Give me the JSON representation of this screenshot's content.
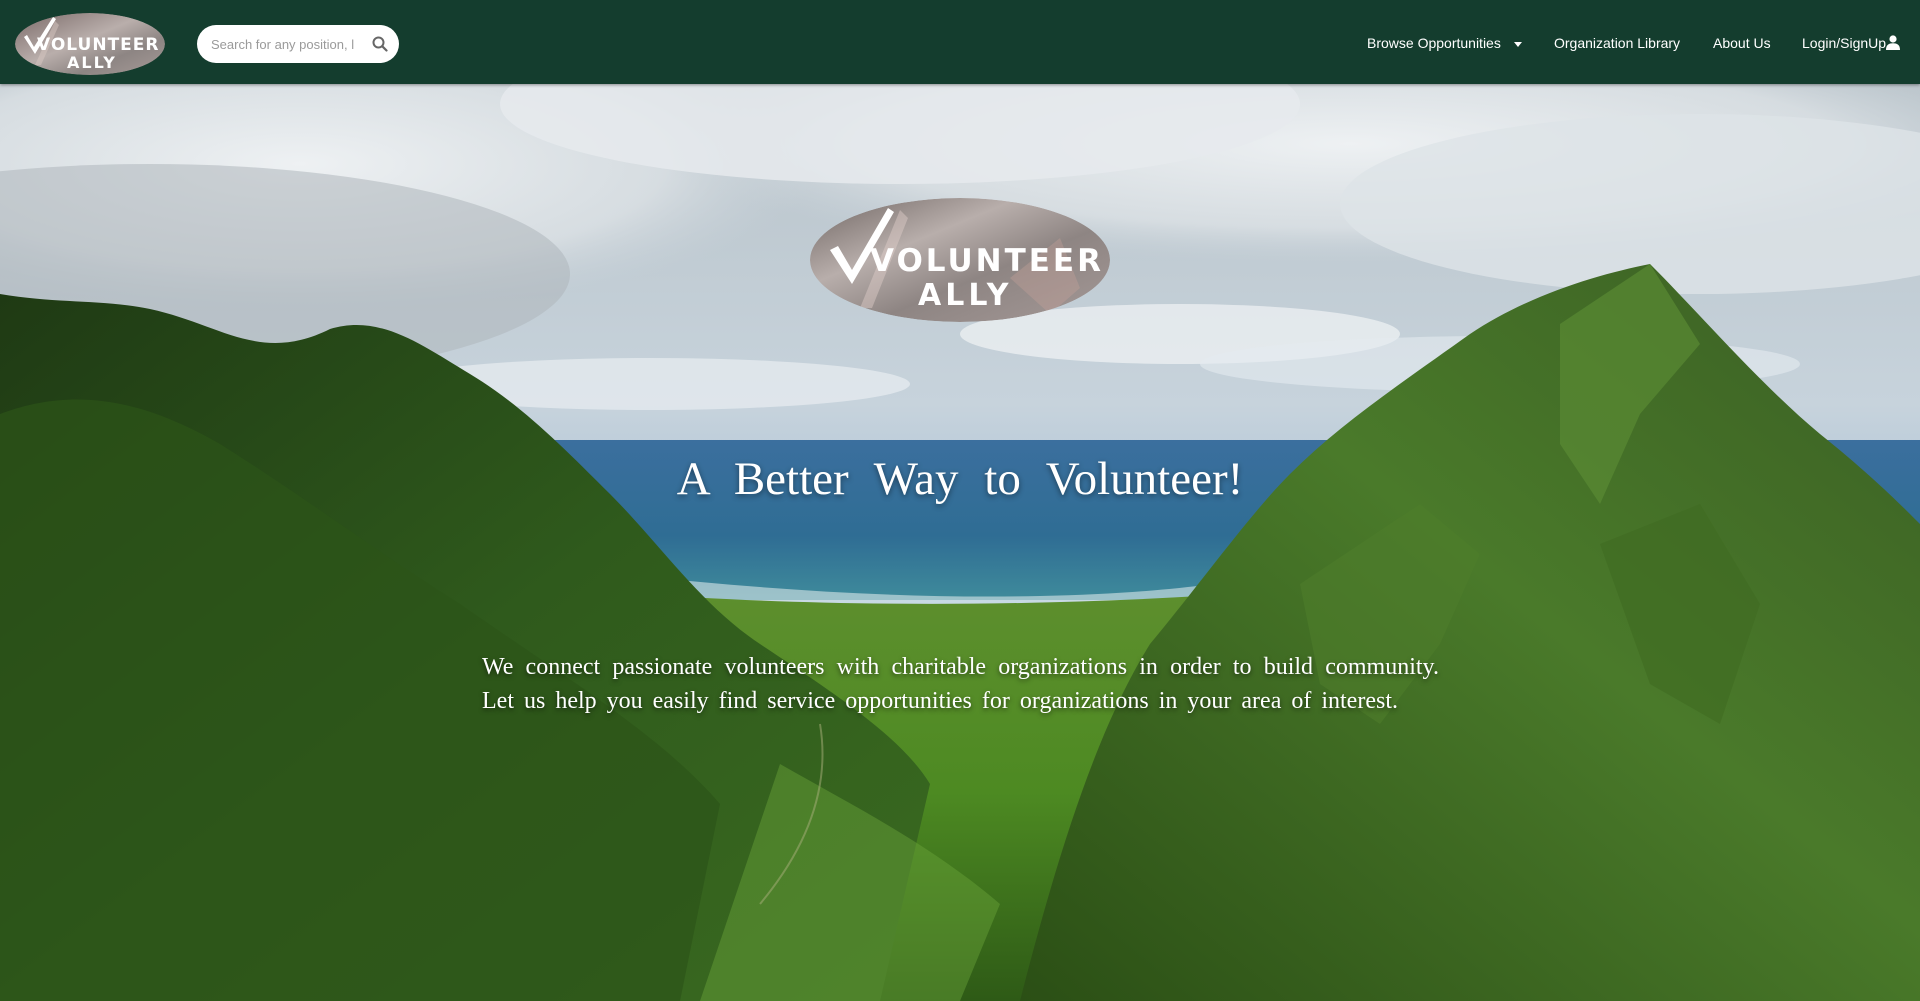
{
  "brand": {
    "logo_line1": "VOLUNTEER",
    "logo_line2": "ALLY"
  },
  "search": {
    "placeholder": "Search for any position, l",
    "value": ""
  },
  "nav": {
    "browse_label": "Browse Opportunities",
    "org_library_label": "Organization Library",
    "about_label": "About Us",
    "login_label": "Login/SignUp"
  },
  "hero": {
    "headline": "A Better Way to Volunteer!",
    "subtext": "We connect passionate volunteers with charitable organizations in order to build community. Let us help you easily find service opportunities for organizations in your area of interest."
  },
  "colors": {
    "navbar": "#143d2e",
    "text": "#ffffff"
  }
}
